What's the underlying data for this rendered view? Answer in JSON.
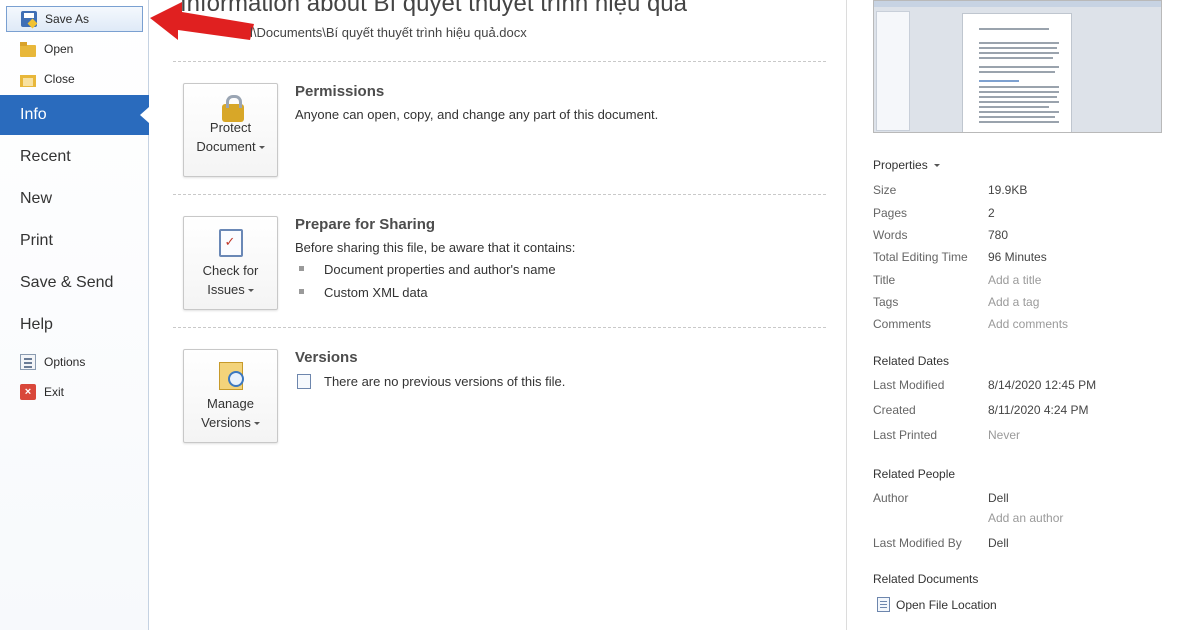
{
  "nav": {
    "commands_top": [
      {
        "label": "Save As",
        "icon": "save-as-icon"
      },
      {
        "label": "Open",
        "icon": "open-folder-icon"
      },
      {
        "label": "Close",
        "icon": "close-file-icon"
      }
    ],
    "tabs": [
      "Info",
      "Recent",
      "New",
      "Print",
      "Save & Send",
      "Help"
    ],
    "commands_bottom": [
      {
        "label": "Options",
        "icon": "options-icon"
      },
      {
        "label": "Exit",
        "icon": "exit-icon"
      }
    ],
    "selected_tab": "Info",
    "accent": "#2a6bbd"
  },
  "info": {
    "title": "Information about Bí quyết thuyết trình hiệu quả",
    "path": "l\\Documents\\Bí quyết thuyết trình hiệu quả.docx",
    "sections": {
      "permissions": {
        "button": [
          "Protect",
          "Document"
        ],
        "heading": "Permissions",
        "text": "Anyone can open, copy, and change any part of this document."
      },
      "sharing": {
        "button": [
          "Check for",
          "Issues"
        ],
        "heading": "Prepare for Sharing",
        "text": "Before sharing this file, be aware that it contains:",
        "items": [
          "Document properties and author's name",
          "Custom XML data"
        ]
      },
      "versions": {
        "button": [
          "Manage",
          "Versions"
        ],
        "heading": "Versions",
        "text": "There are no previous versions of this file."
      }
    }
  },
  "properties": {
    "header": "Properties",
    "rows": [
      {
        "key": "Size",
        "value": "19.9KB"
      },
      {
        "key": "Pages",
        "value": "2"
      },
      {
        "key": "Words",
        "value": "780"
      },
      {
        "key": "Total Editing Time",
        "value": "96 Minutes"
      },
      {
        "key": "Title",
        "value": "Add a title"
      },
      {
        "key": "Tags",
        "value": "Add a tag"
      },
      {
        "key": "Comments",
        "value": "Add comments"
      }
    ],
    "related_dates": {
      "header": "Related Dates",
      "rows": [
        {
          "key": "Last Modified",
          "value": "8/14/2020 12:45 PM"
        },
        {
          "key": "Created",
          "value": "8/11/2020 4:24 PM"
        },
        {
          "key": "Last Printed",
          "value": "Never"
        }
      ]
    },
    "related_people": {
      "header": "Related People",
      "author_key": "Author",
      "author": "Dell",
      "add_author": "Add an author",
      "last_modified_by_key": "Last Modified By",
      "last_modified_by": "Dell"
    },
    "related_documents": {
      "header": "Related Documents",
      "open_location": "Open File Location"
    }
  },
  "annotation": {
    "arrow_color": "#e02020"
  }
}
